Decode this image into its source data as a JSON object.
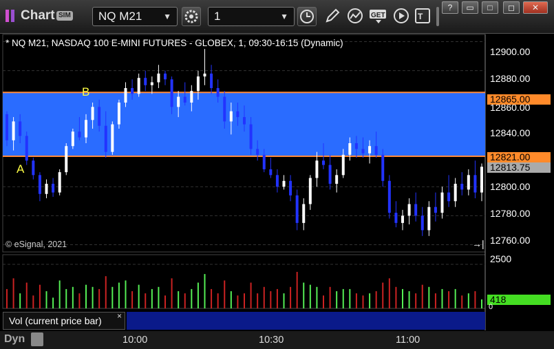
{
  "window": {
    "title": "Chart",
    "sim_badge": "SIM",
    "symbol": "NQ M21",
    "interval": "1",
    "controls": [
      "?",
      "▭",
      "□",
      "✕"
    ]
  },
  "chart": {
    "info_line": "* NQ M21, NASDAQ 100 E-MINI FUTURES - GLOBEX, 1, 09:30-16:15 (Dynamic)",
    "copyright": "© eSignal, 2021",
    "pane_end_icon": "→|",
    "marker_a": "A",
    "marker_b": "B",
    "price_axis": [
      "12900.00",
      "12880.00",
      "12860.00",
      "12840.00",
      "12800.00",
      "12780.00",
      "12760.00"
    ],
    "zone_high_tag": "12865.00",
    "zone_low_tag": "12821.00",
    "last_price_tag": "12813.75",
    "volume_axis_top": "2500",
    "volume_axis_zero": "0",
    "volume_tag": "418",
    "volume_label": "Vol (current price bar)",
    "volume_close": "×",
    "dyn_label": "Dyn",
    "time_axis": [
      "10:00",
      "10:30",
      "11:00"
    ],
    "colors": {
      "zone_fill": "#2a6cff",
      "zone_border": "#ff8a3a",
      "up_bar": "#ffffff",
      "down_bar": "#2233ff",
      "vol_up": "#55ee55",
      "vol_down": "#cc2222",
      "volume_tag": "#44dd22",
      "last_price_tag": "#aaaaaa",
      "markers": "#ffff44"
    }
  },
  "chart_data": {
    "type": "candlestick",
    "zone": {
      "high": 12865,
      "low": 12821
    },
    "y_range": [
      12755,
      12905
    ],
    "volume_range": [
      0,
      2500
    ],
    "ohlc": [
      [
        12850,
        12852,
        12828,
        12832
      ],
      [
        12832,
        12848,
        12825,
        12845
      ],
      [
        12845,
        12850,
        12830,
        12835
      ],
      [
        12835,
        12838,
        12815,
        12818
      ],
      [
        12818,
        12820,
        12805,
        12808
      ],
      [
        12808,
        12810,
        12790,
        12795
      ],
      [
        12795,
        12805,
        12792,
        12802
      ],
      [
        12802,
        12806,
        12793,
        12796
      ],
      [
        12796,
        12812,
        12794,
        12810
      ],
      [
        12810,
        12830,
        12808,
        12828
      ],
      [
        12828,
        12840,
        12826,
        12838
      ],
      [
        12838,
        12848,
        12832,
        12834
      ],
      [
        12834,
        12850,
        12830,
        12846
      ],
      [
        12846,
        12858,
        12840,
        12855
      ],
      [
        12855,
        12860,
        12838,
        12842
      ],
      [
        12842,
        12852,
        12820,
        12824
      ],
      [
        12824,
        12845,
        12822,
        12843
      ],
      [
        12843,
        12860,
        12840,
        12858
      ],
      [
        12858,
        12872,
        12855,
        12868
      ],
      [
        12868,
        12874,
        12860,
        12864
      ],
      [
        12864,
        12878,
        12862,
        12875
      ],
      [
        12875,
        12880,
        12866,
        12870
      ],
      [
        12870,
        12876,
        12864,
        12872
      ],
      [
        12872,
        12884,
        12868,
        12878
      ],
      [
        12878,
        12880,
        12870,
        12874
      ],
      [
        12874,
        12876,
        12850,
        12855
      ],
      [
        12855,
        12866,
        12848,
        12862
      ],
      [
        12862,
        12872,
        12856,
        12858
      ],
      [
        12858,
        12870,
        12852,
        12866
      ],
      [
        12866,
        12880,
        12860,
        12876
      ],
      [
        12876,
        12895,
        12870,
        12878
      ],
      [
        12878,
        12884,
        12864,
        12868
      ],
      [
        12868,
        12874,
        12858,
        12862
      ],
      [
        12862,
        12866,
        12840,
        12845
      ],
      [
        12845,
        12858,
        12836,
        12852
      ],
      [
        12852,
        12858,
        12842,
        12848
      ],
      [
        12848,
        12856,
        12838,
        12843
      ],
      [
        12843,
        12848,
        12822,
        12826
      ],
      [
        12826,
        12832,
        12818,
        12822
      ],
      [
        12822,
        12826,
        12810,
        12812
      ],
      [
        12812,
        12820,
        12806,
        12808
      ],
      [
        12808,
        12812,
        12796,
        12800
      ],
      [
        12800,
        12808,
        12798,
        12804
      ],
      [
        12804,
        12808,
        12790,
        12794
      ],
      [
        12794,
        12798,
        12770,
        12775
      ],
      [
        12775,
        12792,
        12770,
        12788
      ],
      [
        12788,
        12808,
        12784,
        12806
      ],
      [
        12806,
        12824,
        12800,
        12818
      ],
      [
        12818,
        12830,
        12812,
        12815
      ],
      [
        12815,
        12822,
        12798,
        12802
      ],
      [
        12802,
        12812,
        12796,
        12808
      ],
      [
        12808,
        12826,
        12806,
        12822
      ],
      [
        12822,
        12834,
        12818,
        12830
      ],
      [
        12830,
        12835,
        12820,
        12826
      ],
      [
        12826,
        12834,
        12820,
        12823
      ],
      [
        12823,
        12832,
        12816,
        12828
      ],
      [
        12828,
        12838,
        12820,
        12822
      ],
      [
        12822,
        12826,
        12800,
        12804
      ],
      [
        12804,
        12808,
        12778,
        12782
      ],
      [
        12782,
        12790,
        12772,
        12775
      ],
      [
        12775,
        12784,
        12770,
        12780
      ],
      [
        12780,
        12792,
        12774,
        12788
      ],
      [
        12788,
        12796,
        12776,
        12780
      ],
      [
        12780,
        12786,
        12766,
        12770
      ],
      [
        12770,
        12790,
        12766,
        12786
      ],
      [
        12786,
        12796,
        12776,
        12782
      ],
      [
        12782,
        12800,
        12778,
        12796
      ],
      [
        12796,
        12808,
        12786,
        12790
      ],
      [
        12790,
        12806,
        12786,
        12802
      ],
      [
        12802,
        12810,
        12794,
        12798
      ],
      [
        12798,
        12812,
        12794,
        12808
      ],
      [
        12808,
        12818,
        12792,
        12796
      ],
      [
        12796,
        12816,
        12790,
        12813.75
      ]
    ],
    "volume": [
      [
        900,
        "down"
      ],
      [
        1400,
        "down"
      ],
      [
        700,
        "up"
      ],
      [
        1200,
        "down"
      ],
      [
        600,
        "down"
      ],
      [
        1100,
        "down"
      ],
      [
        800,
        "up"
      ],
      [
        500,
        "up"
      ],
      [
        1300,
        "up"
      ],
      [
        900,
        "up"
      ],
      [
        1000,
        "up"
      ],
      [
        700,
        "down"
      ],
      [
        1100,
        "up"
      ],
      [
        1000,
        "up"
      ],
      [
        900,
        "down"
      ],
      [
        1500,
        "down"
      ],
      [
        1000,
        "up"
      ],
      [
        1200,
        "up"
      ],
      [
        1300,
        "up"
      ],
      [
        800,
        "down"
      ],
      [
        1100,
        "up"
      ],
      [
        700,
        "down"
      ],
      [
        900,
        "up"
      ],
      [
        1000,
        "up"
      ],
      [
        600,
        "down"
      ],
      [
        1400,
        "down"
      ],
      [
        800,
        "up"
      ],
      [
        700,
        "down"
      ],
      [
        900,
        "up"
      ],
      [
        1200,
        "up"
      ],
      [
        1600,
        "up"
      ],
      [
        900,
        "down"
      ],
      [
        700,
        "down"
      ],
      [
        1300,
        "down"
      ],
      [
        800,
        "up"
      ],
      [
        600,
        "down"
      ],
      [
        700,
        "down"
      ],
      [
        1200,
        "down"
      ],
      [
        700,
        "down"
      ],
      [
        1000,
        "down"
      ],
      [
        800,
        "down"
      ],
      [
        900,
        "down"
      ],
      [
        700,
        "up"
      ],
      [
        1000,
        "down"
      ],
      [
        1700,
        "down"
      ],
      [
        1200,
        "up"
      ],
      [
        1100,
        "up"
      ],
      [
        1000,
        "up"
      ],
      [
        600,
        "down"
      ],
      [
        1000,
        "down"
      ],
      [
        800,
        "up"
      ],
      [
        900,
        "up"
      ],
      [
        900,
        "up"
      ],
      [
        700,
        "down"
      ],
      [
        600,
        "down"
      ],
      [
        700,
        "up"
      ],
      [
        800,
        "down"
      ],
      [
        1200,
        "down"
      ],
      [
        1400,
        "down"
      ],
      [
        1000,
        "down"
      ],
      [
        900,
        "up"
      ],
      [
        800,
        "up"
      ],
      [
        700,
        "down"
      ],
      [
        1100,
        "down"
      ],
      [
        1000,
        "up"
      ],
      [
        700,
        "down"
      ],
      [
        900,
        "up"
      ],
      [
        800,
        "down"
      ],
      [
        900,
        "up"
      ],
      [
        600,
        "down"
      ],
      [
        700,
        "up"
      ],
      [
        800,
        "down"
      ],
      [
        418,
        "up"
      ]
    ]
  }
}
